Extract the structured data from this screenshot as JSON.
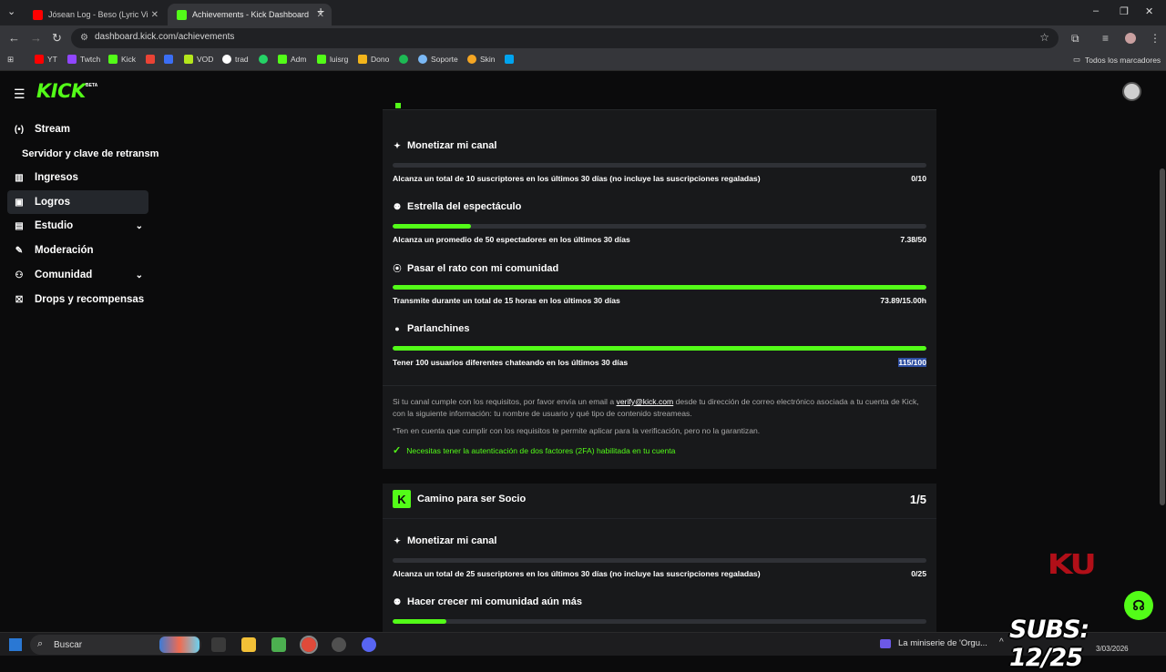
{
  "browser": {
    "tabs": [
      {
        "title": "Jósean Log - Beso (Lyric Vi",
        "fav_color": "#ff0000"
      },
      {
        "title": "Achievements - Kick Dashboard",
        "fav_color": "#53fc18"
      }
    ],
    "url": "dashboard.kick.com/achievements",
    "bookmarks": [
      {
        "label": "YT",
        "color": "#ff0000"
      },
      {
        "label": "Twtch",
        "color": "#9146ff"
      },
      {
        "label": "Kick",
        "color": "#53fc18"
      },
      {
        "label": "",
        "color": "#ea4335"
      },
      {
        "label": "",
        "color": "#3b6ef5"
      },
      {
        "label": "VOD",
        "color": "#b4e61c"
      },
      {
        "label": "trad",
        "color": "#ffffff"
      },
      {
        "label": "",
        "color": "#25d366"
      },
      {
        "label": "Adm",
        "color": "#53fc18"
      },
      {
        "label": "luisrg",
        "color": "#53fc18"
      },
      {
        "label": "Dono",
        "color": "#f2b41b"
      },
      {
        "label": "",
        "color": "#1db954"
      },
      {
        "label": "Soporte",
        "color": "#7ab8f5"
      },
      {
        "label": "Skin",
        "color": "#f5a623"
      },
      {
        "label": "",
        "color": "#00a4ef"
      }
    ],
    "all_bookmarks": "Todos los marcadores"
  },
  "sidebar": {
    "items": [
      {
        "label": "Stream",
        "icon": "broadcast-icon",
        "glyph": "(•)"
      },
      {
        "label": "Ingresos",
        "icon": "bar-chart-icon",
        "glyph": "▥"
      },
      {
        "label": "Logros",
        "icon": "trophy-icon",
        "glyph": "▣"
      },
      {
        "label": "Estudio",
        "icon": "grid-icon",
        "glyph": "▤"
      },
      {
        "label": "Moderación",
        "icon": "wrench-icon",
        "glyph": "✎"
      },
      {
        "label": "Comunidad",
        "icon": "community-icon",
        "glyph": "⚇"
      },
      {
        "label": "Drops y recompensas",
        "icon": "gift-icon",
        "glyph": "⛝"
      }
    ],
    "sub_item": "Servidor y clave de retransm"
  },
  "card1": {
    "achievements": [
      {
        "title": "Monetizar mi canal",
        "icon": "sparkle-icon",
        "glyph": "✦",
        "requirement": "Alcanza un total de 10 suscriptores en los últimos 30 días (no incluye las suscripciones regaladas)",
        "progress": "0/10",
        "fill": 0
      },
      {
        "title": "Estrella del espectáculo",
        "icon": "viewers-icon",
        "glyph": "⚉",
        "requirement": "Alcanza un promedio de 50 espectadores en los últimos 30 días",
        "progress": "7.38/50",
        "fill": 0.1476
      },
      {
        "title": "Pasar el rato con mi comunidad",
        "icon": "broadcast-icon",
        "glyph": "⦿",
        "requirement": "Transmite durante un total de 15 horas en los últimos 30 días",
        "progress": "73.89/15.00h",
        "fill": 1
      },
      {
        "title": "Parlanchines",
        "icon": "chat-icon",
        "glyph": "●",
        "requirement": "Tener 100 usuarios diferentes chateando en los últimos 30 días",
        "progress": "115/100",
        "fill": 1
      }
    ],
    "info_before_link": "Si tu canal cumple con los requisitos, por favor envía un email a ",
    "info_link": "verify@kick.com",
    "info_after_link": " desde tu dirección de correo electrónico asociada a tu cuenta de Kick, con la siguiente información: tu nombre de usuario y qué tipo de contenido streameas.",
    "disclaimer": "*Ten en cuenta que cumplir con los requisitos te permite aplicar para la verificación, pero no la garantizan.",
    "check_text": "Necesitas tener la autenticación de dos factores (2FA) habilitada en tu cuenta"
  },
  "card2": {
    "title": "Camino para ser Socio",
    "count": "1/5",
    "achievements": [
      {
        "title": "Monetizar mi canal",
        "icon": "sparkle-icon",
        "glyph": "✦",
        "requirement": "Alcanza un total de 25 suscriptores en los últimos 30 días (no incluye las suscripciones regaladas)",
        "progress": "0/25",
        "fill": 0
      },
      {
        "title": "Hacer crecer mi comunidad aún más",
        "icon": "viewers-icon",
        "glyph": "⚉",
        "fill": 0.1
      }
    ]
  },
  "overlay": {
    "ku_logo": "KU",
    "subs": "SUBS: 12/25"
  },
  "taskbar": {
    "search": "Buscar",
    "notification": "La miniserie de 'Orgu...",
    "clock": "3/03/2026",
    "apps": [
      {
        "name": "task-view-icon",
        "color": "#3a3a3a"
      },
      {
        "name": "file-explorer-icon",
        "color": "#f2c037"
      },
      {
        "name": "minecraft-icon",
        "color": "#4caf50"
      },
      {
        "name": "chrome-icon",
        "color": "#e04a3a"
      },
      {
        "name": "obs-icon",
        "color": "#505050"
      },
      {
        "name": "discord-icon",
        "color": "#5865f2"
      }
    ]
  }
}
